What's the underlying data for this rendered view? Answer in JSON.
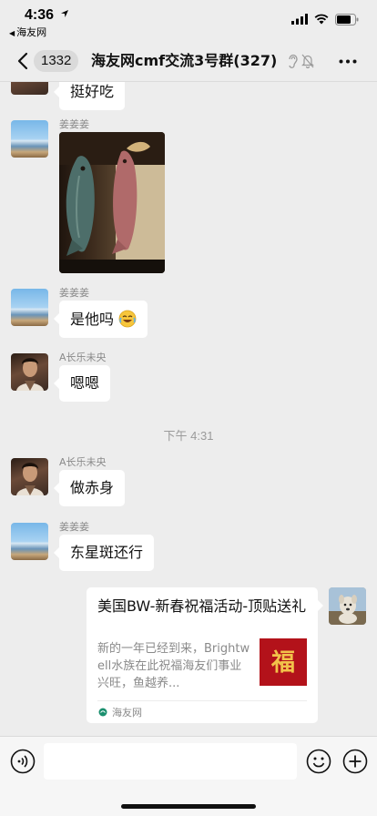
{
  "status_bar": {
    "time": "4:36",
    "back_app": "海友网"
  },
  "nav": {
    "unread_count": "1332",
    "title": "海友网cmf交流3号群(327)",
    "icons": [
      "chevron-left-icon",
      "ear-icon",
      "mute-bell-icon",
      "more-icon"
    ]
  },
  "messages": [
    {
      "text": "挺好吃"
    },
    {
      "sender": "姜姜姜",
      "type": "image"
    },
    {
      "sender": "姜姜姜",
      "text": "是他吗",
      "emoji": "laugh-cry-emoji"
    },
    {
      "sender": "A长乐未央",
      "text": "嗯嗯"
    },
    {
      "sender": "A长乐未央",
      "text": "做赤身"
    },
    {
      "sender": "姜姜姜",
      "text": "东星斑还行"
    }
  ],
  "time_divider": "下午 4:31",
  "card": {
    "title": "美国BW-新春祝福活动-顶贴送礼",
    "description": "新的一年已经到来，Brightwell水族在此祝福海友们事业兴旺，鱼越养...",
    "thumbnail_char": "福",
    "source": "海友网"
  },
  "input_bar": {
    "value": "",
    "icons": [
      "voice-icon",
      "emoji-icon",
      "plus-icon"
    ]
  },
  "colors": {
    "background": "#ededed",
    "bubble": "#ffffff",
    "meta_text": "#8a8a8a",
    "thumbnail_red": "#b3121a"
  }
}
